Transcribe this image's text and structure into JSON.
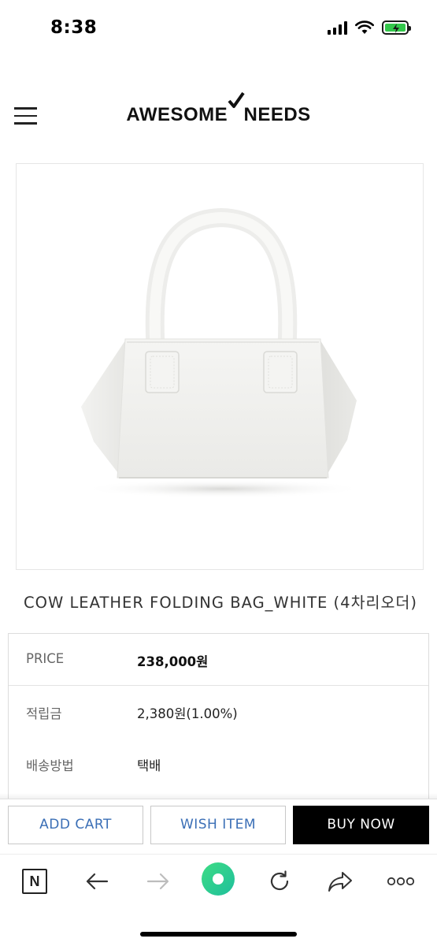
{
  "status_bar": {
    "time": "8:38",
    "battery_color": "#33c74b"
  },
  "header": {
    "logo_left": "AWESOME",
    "logo_right": "NEEDS",
    "menu_icon": "hamburger-menu-icon",
    "logo_mark_icon": "checkmark-icon"
  },
  "product": {
    "image_description_icon": "white-leather-bag-image",
    "title": "COW LEATHER FOLDING BAG_WHITE (4차리오더)"
  },
  "info": {
    "rows": [
      {
        "label": "PRICE",
        "value": "238,000원"
      },
      {
        "label": "적립금",
        "value": "2,380원(1.00%)"
      },
      {
        "label": "배송방법",
        "value": "택배"
      }
    ]
  },
  "actions": {
    "add_cart": "ADD CART",
    "wish_item": "WISH ITEM",
    "buy_now": "BUY NOW",
    "accent_color": "#3b6fb6"
  },
  "toolbar": {
    "n_label": "N",
    "icons": [
      "naver-n-icon",
      "back-arrow-icon",
      "forward-arrow-icon",
      "green-home-dot-icon",
      "refresh-icon",
      "share-icon",
      "more-options-icon"
    ],
    "home_color": "#2fd08c"
  }
}
